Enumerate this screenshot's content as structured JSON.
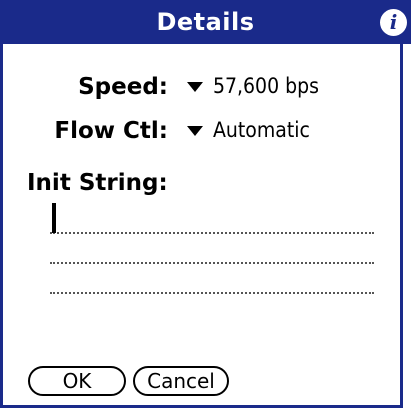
{
  "dialog": {
    "title": "Details",
    "info_icon": "info-icon",
    "speed_label": "Speed:",
    "speed_value": "57,600 bps",
    "flow_label": "Flow Ctl:",
    "flow_value": "Automatic",
    "init_label": "Init String:",
    "init_value": ""
  },
  "buttons": {
    "ok_label": "OK",
    "cancel_label": "Cancel"
  },
  "colors": {
    "accent": "#1a2a8a"
  }
}
